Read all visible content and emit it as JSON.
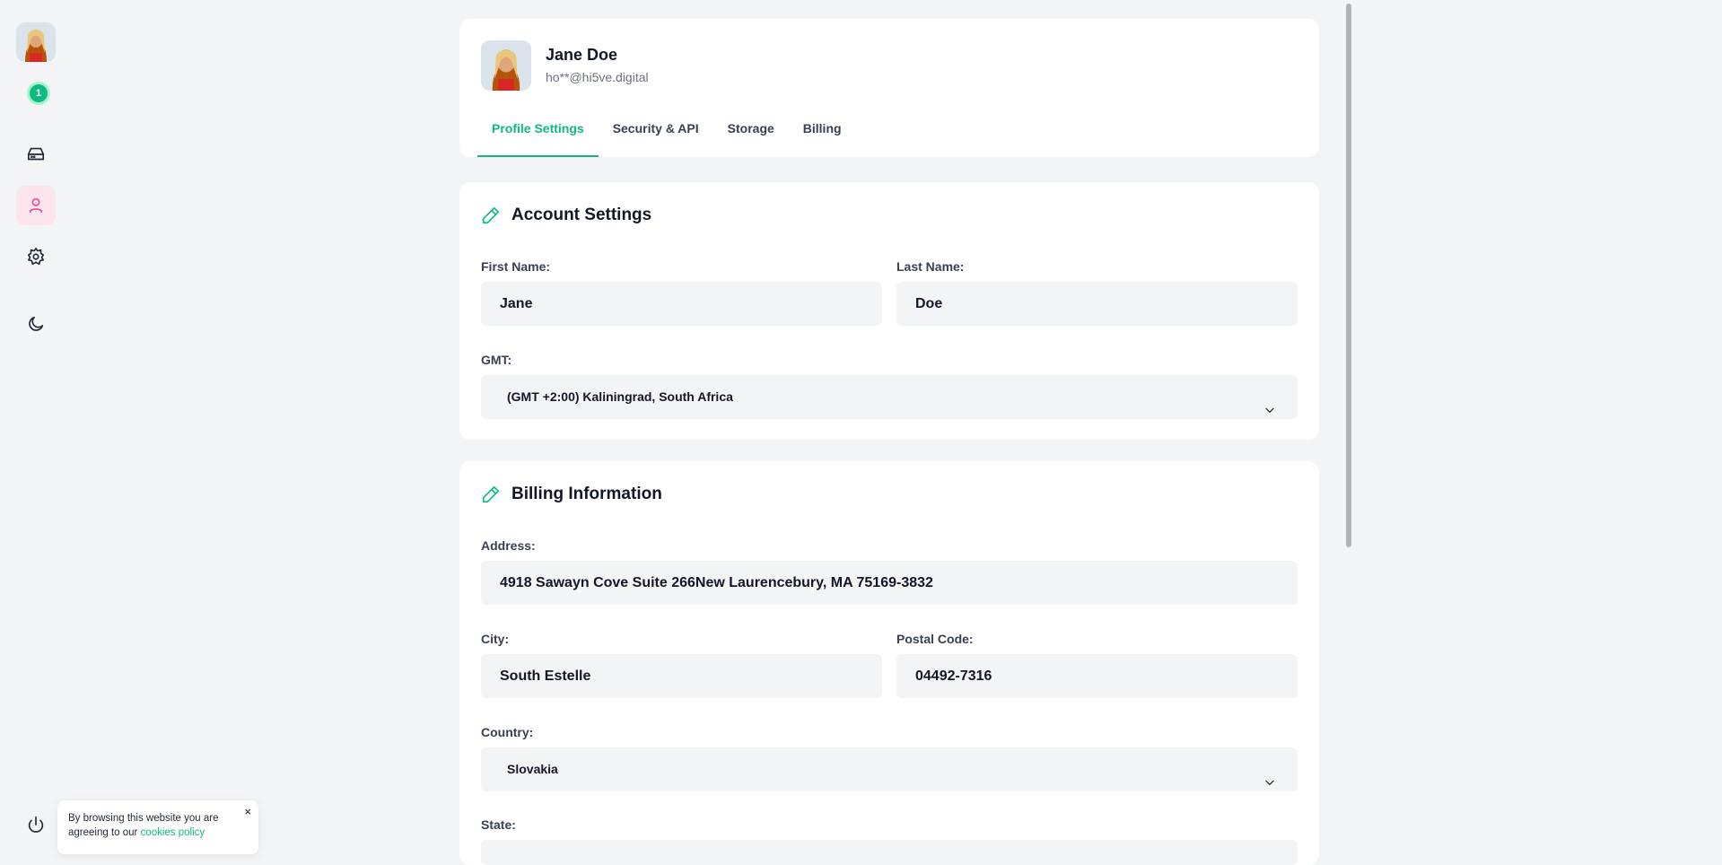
{
  "sidebar": {
    "notification_count": "1",
    "items": [
      {
        "name": "notifications-icon"
      },
      {
        "name": "storage-drive-icon"
      },
      {
        "name": "user-icon",
        "active": true
      },
      {
        "name": "gear-icon"
      },
      {
        "name": "moon-icon"
      },
      {
        "name": "power-icon"
      }
    ],
    "accent_active": "#ec4899"
  },
  "cookie": {
    "text": "By browsing this website you are agreeing to our ",
    "link": "cookies policy",
    "close": "×"
  },
  "profile": {
    "name": "Jane Doe",
    "email": "ho**@hi5ve.digital"
  },
  "tabs": [
    {
      "label": "Profile Settings",
      "active": true
    },
    {
      "label": "Security & API"
    },
    {
      "label": "Storage"
    },
    {
      "label": "Billing"
    }
  ],
  "account": {
    "title": "Account Settings",
    "first_name_label": "First Name:",
    "first_name": "Jane",
    "last_name_label": "Last Name:",
    "last_name": "Doe",
    "gmt_label": "GMT:",
    "gmt": "(GMT +2:00) Kaliningrad, South Africa"
  },
  "billing": {
    "title": "Billing Information",
    "address_label": "Address:",
    "address": "4918 Sawayn Cove Suite 266New Laurencebury, MA 75169-3832",
    "city_label": "City:",
    "city": "South Estelle",
    "postal_label": "Postal Code:",
    "postal": "04492-7316",
    "country_label": "Country:",
    "country": "Slovakia",
    "state_label": "State:"
  },
  "colors": {
    "accent": "#10b981",
    "background": "#f3f4f6",
    "card": "#ffffff"
  }
}
